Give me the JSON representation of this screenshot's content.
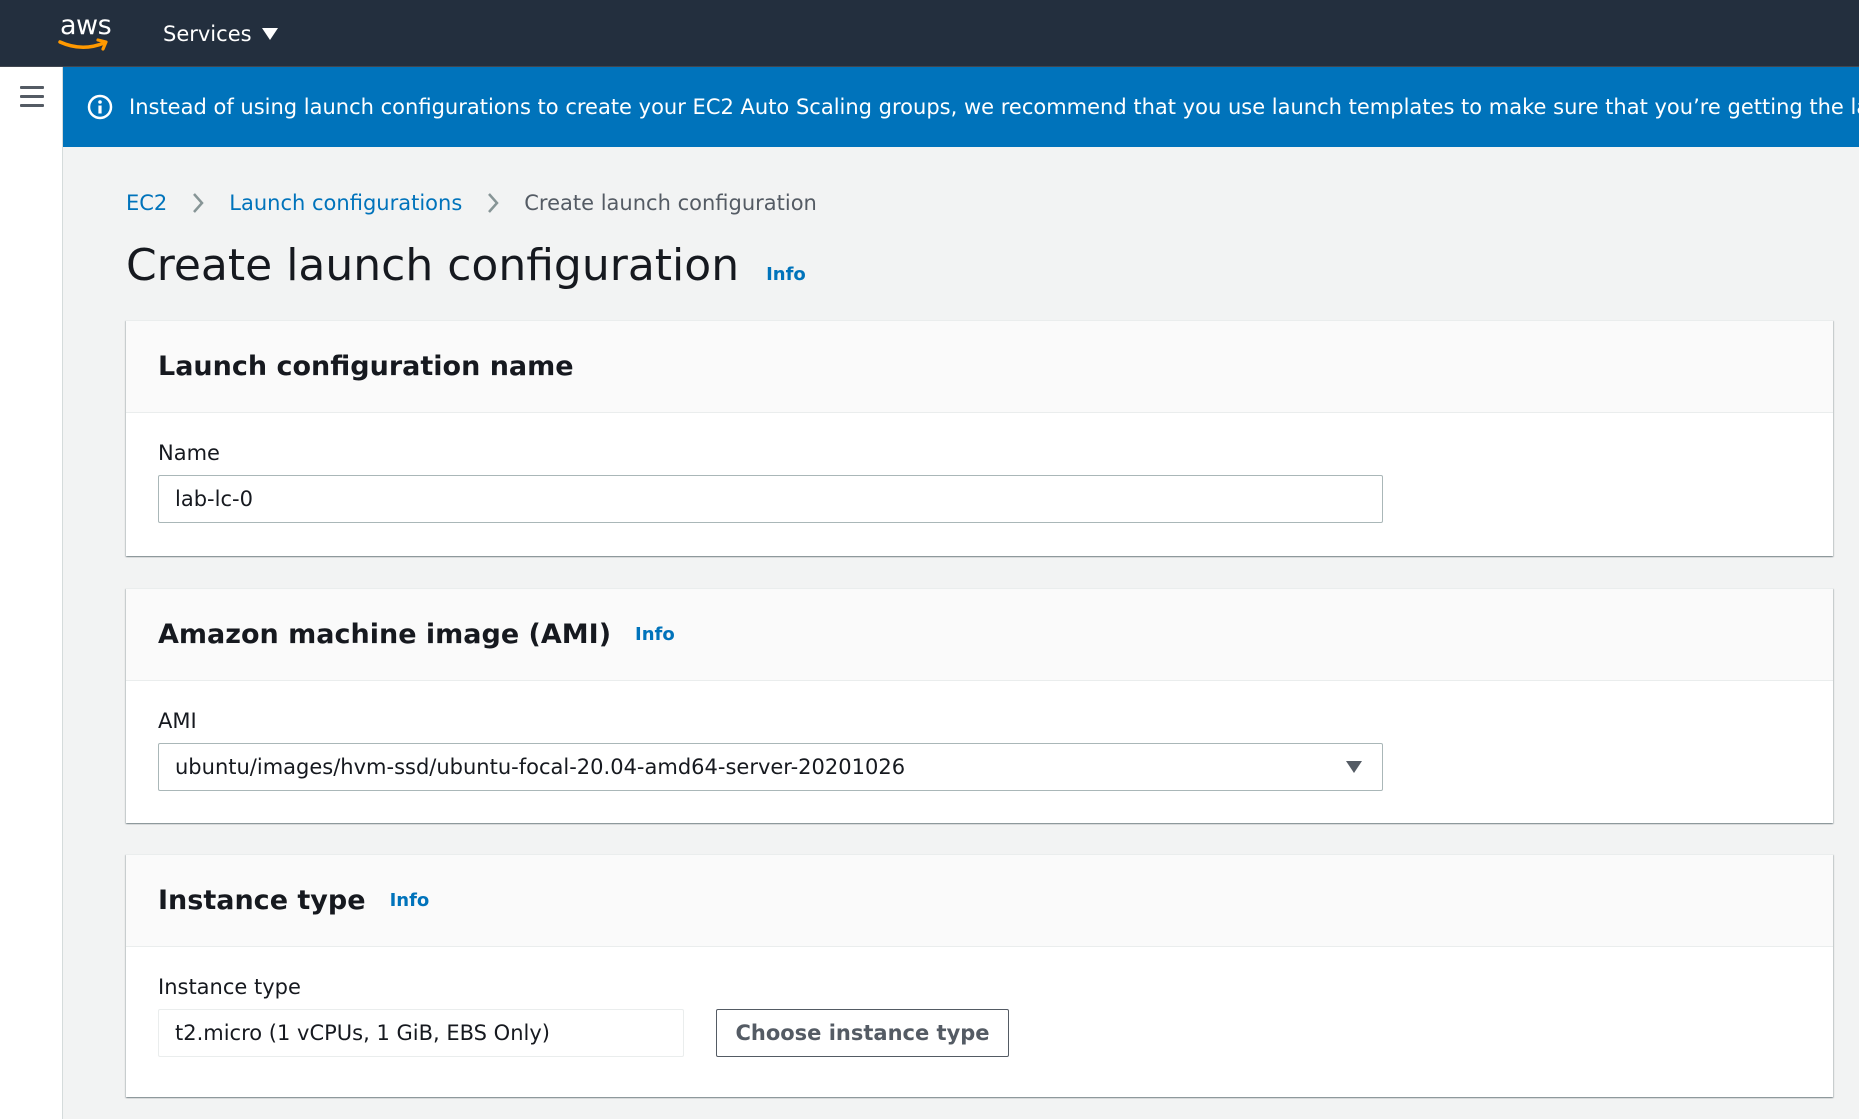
{
  "topnav": {
    "logo_text": "aws",
    "services_label": "Services"
  },
  "flash": {
    "message": "Instead of using launch configurations to create your EC2 Auto Scaling groups, we recommend that you use launch templates to make sure that you’re getting the latest feat"
  },
  "breadcrumb": {
    "items": [
      "EC2",
      "Launch configurations",
      "Create launch configuration"
    ]
  },
  "page": {
    "title": "Create launch configuration",
    "info_label": "Info"
  },
  "sections": {
    "name": {
      "title": "Launch configuration name",
      "field_label": "Name",
      "field_value": "lab-lc-0"
    },
    "ami": {
      "title": "Amazon machine image (AMI)",
      "info_label": "Info",
      "field_label": "AMI",
      "selected_value": "ubuntu/images/hvm-ssd/ubuntu-focal-20.04-amd64-server-20201026"
    },
    "instance_type": {
      "title": "Instance type",
      "info_label": "Info",
      "field_label": "Instance type",
      "field_value": "t2.micro (1 vCPUs, 1 GiB, EBS Only)",
      "button_label": "Choose instance type"
    }
  },
  "colors": {
    "topnav_bg": "#232f3e",
    "flash_bg": "#0073bb",
    "link": "#0073bb",
    "page_bg": "#f2f3f3"
  },
  "icons": {
    "menu": "hamburger-menu-icon",
    "flash": "info-circle-icon",
    "breadcrumb_separator": "chevron-right-icon",
    "services_caret": "caret-down-icon",
    "select_caret": "caret-down-icon"
  }
}
